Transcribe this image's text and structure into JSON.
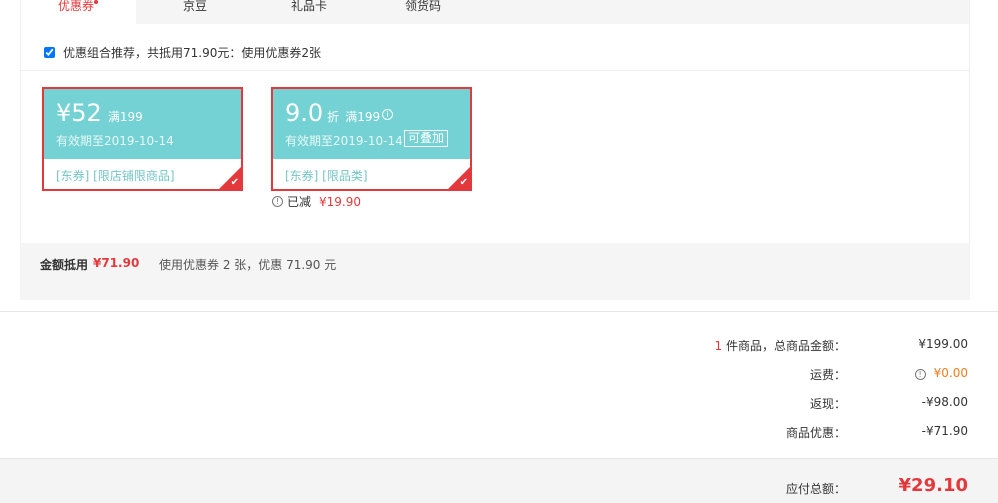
{
  "tabs": [
    {
      "label": "优惠券",
      "active": true
    },
    {
      "label": "京豆"
    },
    {
      "label": "礼品卡"
    },
    {
      "label": "领货码"
    }
  ],
  "combo": {
    "label": "优惠组合推荐，共抵用71.90元：使用优惠券2张",
    "checked": true
  },
  "coupons": [
    {
      "amount": "¥52",
      "condition": "满199",
      "valid": "有效期至2019-10-14",
      "tags": "[东券]  [限店铺限商品]"
    },
    {
      "amount": "9.0",
      "unit": "折",
      "condition": "满199",
      "valid": "有效期至2019-10-14",
      "stack_badge": "可叠加",
      "tags": "[东券]  [限品类]",
      "reduced_label": "已减",
      "reduced_value": "¥19.90"
    }
  ],
  "summary": {
    "label": "金额抵用",
    "amount": "¥71.90",
    "desc": "使用优惠券 2 张，优惠 71.90 元"
  },
  "order": {
    "items_count": "1",
    "items_label": " 件商品，总商品金额：",
    "items_value": "¥199.00",
    "shipping_label": "运费：",
    "shipping_value": "¥0.00",
    "cashback_label": "返现：",
    "cashback_value": "-¥98.00",
    "discount_label": "商品优惠：",
    "discount_value": "-¥71.90",
    "total_label": "应付总额：",
    "total_value": "¥29.10"
  },
  "colors": {
    "accent": "#e4393c",
    "coupon": "#74d2d4",
    "orange": "#f37b1d"
  }
}
